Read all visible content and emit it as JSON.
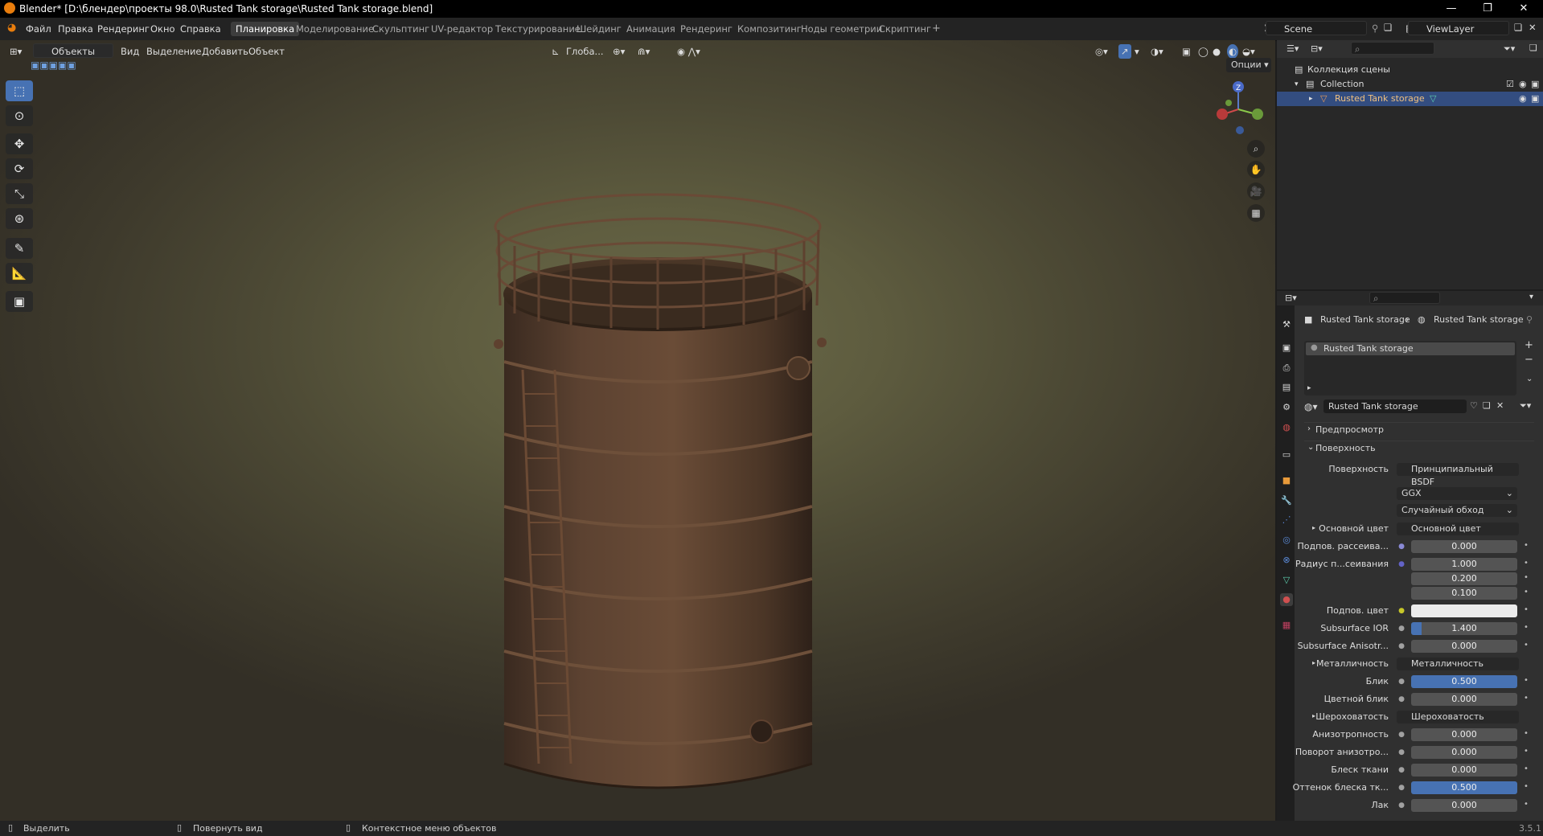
{
  "title_bar": {
    "title": "Blender* [D:\\блендер\\проекты 98.0\\Rusted Tank storage\\Rusted Tank storage.blend]",
    "minimize": "—",
    "restore": "❐",
    "close": "✕"
  },
  "menu": {
    "items": [
      "Файл",
      "Правка",
      "Рендеринг",
      "Окно",
      "Справка"
    ]
  },
  "workspaces": {
    "tabs": [
      "Планировка",
      "Моделирование",
      "Скульптинг",
      "UV-редактор",
      "Текстурирование",
      "Шейдинг",
      "Анимация",
      "Рендеринг",
      "Композитинг",
      "Ноды геометрии",
      "Скриптинг"
    ],
    "active": "Планировка",
    "add": "+"
  },
  "scene": {
    "name": "Scene",
    "view_layer": "ViewLayer"
  },
  "viewport_header": {
    "mode": "Объекты",
    "view": "Вид",
    "select": "Выделение",
    "add": "Добавить",
    "object": "Объект",
    "orientation": "Глоба...",
    "options": "Опции"
  },
  "gizmo": {
    "z": "Z",
    "y": "Y",
    "x": "X"
  },
  "outliner": {
    "scene_collection": "Коллекция сцены",
    "collection": "Collection",
    "object": "Rusted Tank storage"
  },
  "properties": {
    "breadcrumb_obj": "Rusted Tank storage",
    "breadcrumb_mat": "Rusted Tank storage",
    "slot": "Rusted Tank storage",
    "material_name": "Rusted Tank storage",
    "preview": "Предпросмотр",
    "surface_panel": "Поверхность",
    "rows": [
      {
        "label": "Поверхность",
        "value": "Принципиальный BSDF",
        "kind": "socket",
        "sock": "#5cb85c"
      },
      {
        "label": "",
        "value": "GGX",
        "kind": "dropdown"
      },
      {
        "label": "",
        "value": "Случайный обход",
        "kind": "dropdown"
      },
      {
        "label": "Основной цвет",
        "value": "Основной цвет",
        "kind": "socket",
        "sock": "#c7c729",
        "expand": true
      },
      {
        "label": "Подпов. рассеива...",
        "value": "0.000",
        "kind": "num",
        "sock": "#8a8ad6"
      },
      {
        "label": "Радиус п...сеивания",
        "value": "1.000",
        "kind": "num",
        "sock": "#6363c7"
      },
      {
        "label": "",
        "value": "0.200",
        "kind": "num"
      },
      {
        "label": "",
        "value": "0.100",
        "kind": "num"
      },
      {
        "label": "Подпов. цвет",
        "value": "",
        "kind": "color",
        "sock": "#c7c729"
      },
      {
        "label": "Subsurface IOR",
        "value": "1.400",
        "kind": "num",
        "sock": "#a1a1a1",
        "fill": 0.1
      },
      {
        "label": "Subsurface Anisotr...",
        "value": "0.000",
        "kind": "num",
        "sock": "#a1a1a1"
      },
      {
        "label": "Металличность",
        "value": "Металличность",
        "kind": "socket",
        "sock": "#a1a1a1",
        "expand": true
      },
      {
        "label": "Блик",
        "value": "0.500",
        "kind": "num",
        "sock": "#a1a1a1",
        "blue": true
      },
      {
        "label": "Цветной блик",
        "value": "0.000",
        "kind": "num",
        "sock": "#a1a1a1"
      },
      {
        "label": "Шероховатость",
        "value": "Шероховатость",
        "kind": "socket",
        "sock": "#a1a1a1",
        "expand": true
      },
      {
        "label": "Анизотропность",
        "value": "0.000",
        "kind": "num",
        "sock": "#a1a1a1"
      },
      {
        "label": "Поворот анизотро...",
        "value": "0.000",
        "kind": "num",
        "sock": "#a1a1a1"
      },
      {
        "label": "Блеск ткани",
        "value": "0.000",
        "kind": "num",
        "sock": "#a1a1a1"
      },
      {
        "label": "Оттенок блеска тк...",
        "value": "0.500",
        "kind": "num",
        "sock": "#a1a1a1",
        "blue": true
      },
      {
        "label": "Лак",
        "value": "0.000",
        "kind": "num",
        "sock": "#a1a1a1"
      }
    ]
  },
  "status": {
    "select": "Выделить",
    "rotate": "Повернуть вид",
    "context": "Контекстное меню объектов",
    "version": "3.5.1"
  }
}
